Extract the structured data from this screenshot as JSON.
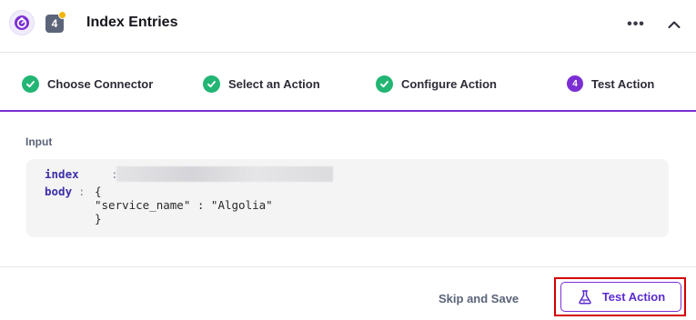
{
  "header": {
    "step_number": "4",
    "title": "Index Entries",
    "more_label": "•••",
    "collapse_icon": "chevron-up-icon"
  },
  "steps": [
    {
      "label": "Choose Connector",
      "state": "complete"
    },
    {
      "label": "Select an Action",
      "state": "complete"
    },
    {
      "label": "Configure Action",
      "state": "complete"
    },
    {
      "label": "Test Action",
      "state": "current",
      "number": "4"
    }
  ],
  "input": {
    "label": "Input",
    "fields": [
      {
        "key": "index",
        "separator": ":",
        "value": ""
      },
      {
        "key": "body",
        "separator": ":",
        "value_lines": [
          "{",
          "\"service_name\" : \"Algolia\"",
          "}"
        ]
      }
    ]
  },
  "footer": {
    "skip_label": "Skip and Save",
    "test_label": "Test Action"
  },
  "colors": {
    "accent": "#7b2fd3",
    "success": "#22b573",
    "highlight": "#d50000",
    "badge": "#f2b705"
  }
}
